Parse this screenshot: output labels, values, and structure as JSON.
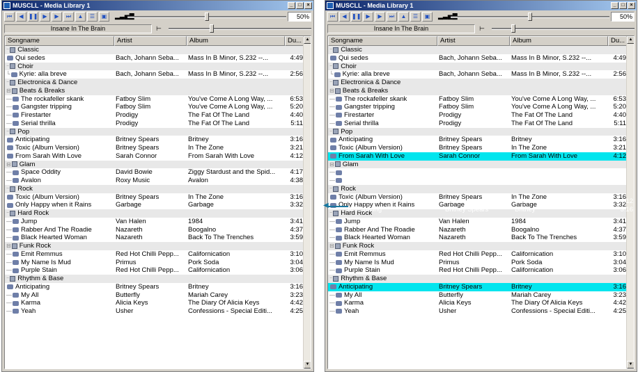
{
  "left_window": {
    "title": "MUSCLL - Media Library 1",
    "volume_pct": "50%",
    "volume_level": 0.5,
    "now_playing": "Insane In The Brain",
    "seek_position": 0.3
  },
  "right_window": {
    "title": "MUSCLL - Media Library 1",
    "volume_pct": "50%",
    "volume_level": 0.5,
    "now_playing": "Insane In The Brain",
    "seek_position": 0.15
  },
  "window_controls": {
    "minimize": "_",
    "maximize": "□",
    "close": "×"
  },
  "toolbar_buttons": [
    "prev-icon",
    "back-icon",
    "pause-icon",
    "play-icon",
    "next-icon",
    "skip-end-icon",
    "eject-icon",
    "playlist-icon",
    "save-icon"
  ],
  "toolbar_glyphs": [
    "⏮",
    "◀",
    "❚❚",
    "▶",
    "▶",
    "⏭",
    "▲",
    "☰",
    "▣"
  ],
  "volume_icon": "▂▃▅▇",
  "columns": [
    "Songname",
    "Artist",
    "Album",
    "Du..."
  ],
  "colors": {
    "selection": "#00e5ee",
    "group_bg": "#e8e8e8",
    "drop_indicator": "#1a78a0"
  },
  "left_rows": [
    {
      "type": "group",
      "tree": "⁻",
      "name": "Classic",
      "artist": "",
      "album": "",
      "dur": ""
    },
    {
      "type": "song",
      "tree": "",
      "name": "Qui sedes",
      "artist": "Bach, Johann Seba...",
      "album": "Mass In B Minor, S.232 --...",
      "dur": "4:49"
    },
    {
      "type": "group",
      "tree": "⁻",
      "name": "Choir",
      "artist": "",
      "album": "",
      "dur": ""
    },
    {
      "type": "song",
      "tree": "└",
      "name": "Kyrie: alla breve",
      "artist": "Bach, Johann Seba...",
      "album": "Mass In B Minor, S.232 --...",
      "dur": "2:56"
    },
    {
      "type": "group",
      "tree": "⁻",
      "name": "Electronica & Dance",
      "artist": "",
      "album": "",
      "dur": ""
    },
    {
      "type": "group",
      "tree": "⊟",
      "name": "Beats & Breaks",
      "artist": "",
      "album": "",
      "dur": ""
    },
    {
      "type": "song",
      "tree": "—",
      "name": "The rockafeller skank",
      "artist": "Fatboy Slim",
      "album": "You've Come A Long Way, ...",
      "dur": "6:53"
    },
    {
      "type": "song",
      "tree": "—",
      "name": "Gangster tripping",
      "artist": "Fatboy Slim",
      "album": "You've Come A Long Way, ...",
      "dur": "5:20"
    },
    {
      "type": "song",
      "tree": "—",
      "name": "Firestarter",
      "artist": "Prodigy",
      "album": "The Fat Of The Land",
      "dur": "4:40"
    },
    {
      "type": "song",
      "tree": "—",
      "name": "Serial thrilla",
      "artist": "Prodigy",
      "album": "The Fat Of The Land",
      "dur": "5:11"
    },
    {
      "type": "group",
      "tree": "⁻",
      "name": "Pop",
      "artist": "",
      "album": "",
      "dur": ""
    },
    {
      "type": "song",
      "tree": "",
      "name": "Anticipating",
      "artist": "Britney Spears",
      "album": "Britney",
      "dur": "3:16"
    },
    {
      "type": "song",
      "tree": "",
      "name": "Toxic (Album Version)",
      "artist": "Britney Spears",
      "album": "In The Zone",
      "dur": "3:21"
    },
    {
      "type": "song",
      "tree": "",
      "name": "From Sarah With Love",
      "artist": "Sarah Connor",
      "album": "From Sarah With Love",
      "dur": "4:12"
    },
    {
      "type": "group",
      "tree": "⊟",
      "name": "Glam",
      "artist": "",
      "album": "",
      "dur": ""
    },
    {
      "type": "song",
      "tree": "—",
      "name": "Space Oddity",
      "artist": "David Bowie",
      "album": "Ziggy Stardust and the Spid...",
      "dur": "4:17"
    },
    {
      "type": "song",
      "tree": "—",
      "name": "Avalon",
      "artist": "Roxy Music",
      "album": "Avalon",
      "dur": "4:38"
    },
    {
      "type": "group",
      "tree": "⁻",
      "name": "Rock",
      "artist": "",
      "album": "",
      "dur": ""
    },
    {
      "type": "song",
      "tree": "",
      "name": "Toxic (Album Version)",
      "artist": "Britney Spears",
      "album": "In The Zone",
      "dur": "3:16"
    },
    {
      "type": "song",
      "tree": "",
      "name": "Only Happy when it Rains",
      "artist": "Garbage",
      "album": "Garbage",
      "dur": "3:32"
    },
    {
      "type": "group",
      "tree": "⁻",
      "name": "Hard Rock",
      "artist": "",
      "album": "",
      "dur": ""
    },
    {
      "type": "song",
      "tree": "—",
      "name": "Jump",
      "artist": "Van Halen",
      "album": "1984",
      "dur": "3:41"
    },
    {
      "type": "song",
      "tree": "—",
      "name": "Rabber And The Roadie",
      "artist": "Nazareth",
      "album": "Boogalno",
      "dur": "4:37"
    },
    {
      "type": "song",
      "tree": "—",
      "name": "Black Hearted Woman",
      "artist": "Nazareth",
      "album": "Back To The Trenches",
      "dur": "3:59"
    },
    {
      "type": "group",
      "tree": "⊟",
      "name": "Funk Rock",
      "artist": "",
      "album": "",
      "dur": ""
    },
    {
      "type": "song",
      "tree": "—",
      "name": "Emit Remmus",
      "artist": "Red Hot Chilli Pepp...",
      "album": "Californication",
      "dur": "3:10"
    },
    {
      "type": "song",
      "tree": "—",
      "name": "My Name Is Mud",
      "artist": "Primus",
      "album": "Pork Soda",
      "dur": "3:04"
    },
    {
      "type": "song",
      "tree": "—",
      "name": "Purple Stain",
      "artist": "Red Hot Chilli Pepp...",
      "album": "Californication",
      "dur": "3:06"
    },
    {
      "type": "group",
      "tree": "⁻",
      "name": "Rhythm & Base",
      "artist": "",
      "album": "",
      "dur": ""
    },
    {
      "type": "song",
      "tree": "",
      "name": "Anticipating",
      "artist": "Britney Spears",
      "album": "Britney",
      "dur": "3:16"
    },
    {
      "type": "song",
      "tree": "—",
      "name": "My All",
      "artist": "Butterfly",
      "album": "Mariah Carey",
      "dur": "3:23"
    },
    {
      "type": "song",
      "tree": "—",
      "name": "Karma",
      "artist": "Alicia Keys",
      "album": "The Diary Of Alicia Keys",
      "dur": "4:42"
    },
    {
      "type": "song",
      "tree": "—",
      "name": "Yeah",
      "artist": "Usher",
      "album": "Confessions - Special Editi...",
      "dur": "4:25"
    }
  ],
  "right_rows": [
    {
      "type": "group",
      "tree": "⁻",
      "name": "Classic",
      "artist": "",
      "album": "",
      "dur": ""
    },
    {
      "type": "song",
      "tree": "",
      "name": "Qui sedes",
      "artist": "Bach, Johann Seba...",
      "album": "Mass In B Minor, S.232 --...",
      "dur": "4:49"
    },
    {
      "type": "group",
      "tree": "⁻",
      "name": "Choir",
      "artist": "",
      "album": "",
      "dur": ""
    },
    {
      "type": "song",
      "tree": "└",
      "name": "Kyrie: alla breve",
      "artist": "Bach, Johann Seba...",
      "album": "Mass In B Minor, S.232 --...",
      "dur": "2:56"
    },
    {
      "type": "group",
      "tree": "⁻",
      "name": "Electronica & Dance",
      "artist": "",
      "album": "",
      "dur": ""
    },
    {
      "type": "group",
      "tree": "⊟",
      "name": "Beats & Breaks",
      "artist": "",
      "album": "",
      "dur": ""
    },
    {
      "type": "song",
      "tree": "—",
      "name": "The rockafeller skank",
      "artist": "Fatboy Slim",
      "album": "You've Come A Long Way, ...",
      "dur": "6:53"
    },
    {
      "type": "song",
      "tree": "—",
      "name": "Gangster tripping",
      "artist": "Fatboy Slim",
      "album": "You've Come A Long Way, ...",
      "dur": "5:20"
    },
    {
      "type": "song",
      "tree": "—",
      "name": "Firestarter",
      "artist": "Prodigy",
      "album": "The Fat Of The Land",
      "dur": "4:40"
    },
    {
      "type": "song",
      "tree": "—",
      "name": "Serial thrilla",
      "artist": "Prodigy",
      "album": "The Fat Of The Land",
      "dur": "5:11"
    },
    {
      "type": "group",
      "tree": "⁻",
      "name": "Pop",
      "artist": "",
      "album": "",
      "dur": ""
    },
    {
      "type": "song",
      "tree": "",
      "name": "Anticipating",
      "artist": "Britney Spears",
      "album": "Britney",
      "dur": "3:16"
    },
    {
      "type": "song",
      "tree": "",
      "name": "Toxic (Album Version)",
      "artist": "Britney Spears",
      "album": "In The Zone",
      "dur": "3:21"
    },
    {
      "type": "song",
      "tree": "",
      "name": "From Sarah With Love",
      "artist": "Sarah Connor",
      "album": "From Sarah With Love",
      "dur": "4:12",
      "selected": true
    },
    {
      "type": "group",
      "tree": "⊟",
      "name": "Glam",
      "artist": "",
      "album": "",
      "dur": ""
    },
    {
      "type": "ghost",
      "tree": "—",
      "name": "",
      "artist": "",
      "album": "",
      "dur": ""
    },
    {
      "type": "ghost",
      "tree": "—",
      "name": "",
      "artist": "",
      "album": "",
      "dur": ""
    },
    {
      "type": "group",
      "tree": "⁻",
      "name": "Rock",
      "artist": "",
      "album": "",
      "dur": ""
    },
    {
      "type": "song",
      "tree": "",
      "name": "Toxic (Album Version)",
      "artist": "Britney Spears",
      "album": "In The Zone",
      "dur": "3:16"
    },
    {
      "type": "song",
      "tree": "",
      "name": "Only Happy when it Rains",
      "artist": "Garbage",
      "album": "Garbage",
      "dur": "3:32"
    },
    {
      "type": "group",
      "tree": "⁻",
      "name": "Hard Rock",
      "artist": "",
      "album": "",
      "dur": ""
    },
    {
      "type": "song",
      "tree": "—",
      "name": "Jump",
      "artist": "Van Halen",
      "album": "1984",
      "dur": "3:41"
    },
    {
      "type": "song",
      "tree": "—",
      "name": "Rabber And The Roadie",
      "artist": "Nazareth",
      "album": "Boogalno",
      "dur": "4:37"
    },
    {
      "type": "song",
      "tree": "—",
      "name": "Black Hearted Woman",
      "artist": "Nazareth",
      "album": "Back To The Trenches",
      "dur": "3:59"
    },
    {
      "type": "group",
      "tree": "⊟",
      "name": "Funk Rock",
      "artist": "",
      "album": "",
      "dur": ""
    },
    {
      "type": "song",
      "tree": "—",
      "name": "Emit Remmus",
      "artist": "Red Hot Chilli Pepp...",
      "album": "Californication",
      "dur": "3:10"
    },
    {
      "type": "song",
      "tree": "—",
      "name": "My Name Is Mud",
      "artist": "Primus",
      "album": "Pork Soda",
      "dur": "3:04"
    },
    {
      "type": "song",
      "tree": "—",
      "name": "Purple Stain",
      "artist": "Red Hot Chilli Pepp...",
      "album": "Californication",
      "dur": "3:06"
    },
    {
      "type": "group",
      "tree": "⁻",
      "name": "Rhythm & Base",
      "artist": "",
      "album": "",
      "dur": ""
    },
    {
      "type": "song",
      "tree": "",
      "name": "Anticipating",
      "artist": "Britney Spears",
      "album": "Britney",
      "dur": "3:16",
      "selected": true
    },
    {
      "type": "song",
      "tree": "—",
      "name": "My All",
      "artist": "Butterfly",
      "album": "Mariah Carey",
      "dur": "3:23"
    },
    {
      "type": "song",
      "tree": "—",
      "name": "Karma",
      "artist": "Alicia Keys",
      "album": "The Diary Of Alicia Keys",
      "dur": "4:42"
    },
    {
      "type": "song",
      "tree": "—",
      "name": "Yeah",
      "artist": "Usher",
      "album": "Confessions - Special Editi...",
      "dur": "4:25"
    }
  ],
  "drag_ghost_rows": [
    {
      "name": "From Sarah With Love",
      "artist": "Sarah Connor",
      "album": "From Sarah With Love",
      "dur": "4:12"
    },
    {
      "name": "Anticipating",
      "artist": "Britney Spears",
      "album": "Britney",
      "dur": "3:16"
    }
  ]
}
